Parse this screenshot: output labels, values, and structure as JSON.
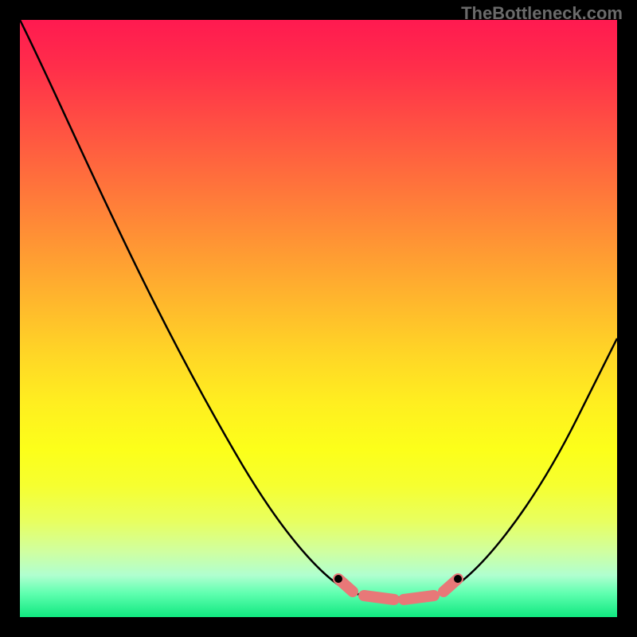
{
  "watermark": "TheBottleneck.com",
  "chart_data": {
    "type": "line",
    "title": "",
    "xlabel": "",
    "ylabel": "",
    "xlim": [
      0,
      100
    ],
    "ylim": [
      0,
      100
    ],
    "gradient_stops": [
      {
        "pos": 0,
        "color": "#ff1a50"
      },
      {
        "pos": 50,
        "color": "#ffd626"
      },
      {
        "pos": 85,
        "color": "#f6ff30"
      },
      {
        "pos": 100,
        "color": "#10e880"
      }
    ],
    "curve": {
      "description": "V-shaped bottleneck curve with flat minimum region",
      "points": [
        {
          "x": 0,
          "y": 100
        },
        {
          "x": 55,
          "y": 5
        },
        {
          "x": 70,
          "y": 5
        },
        {
          "x": 100,
          "y": 50
        }
      ],
      "minimum_region": {
        "x_start": 55,
        "x_end": 70,
        "y": 5
      },
      "highlight_color": "#e87878"
    }
  }
}
